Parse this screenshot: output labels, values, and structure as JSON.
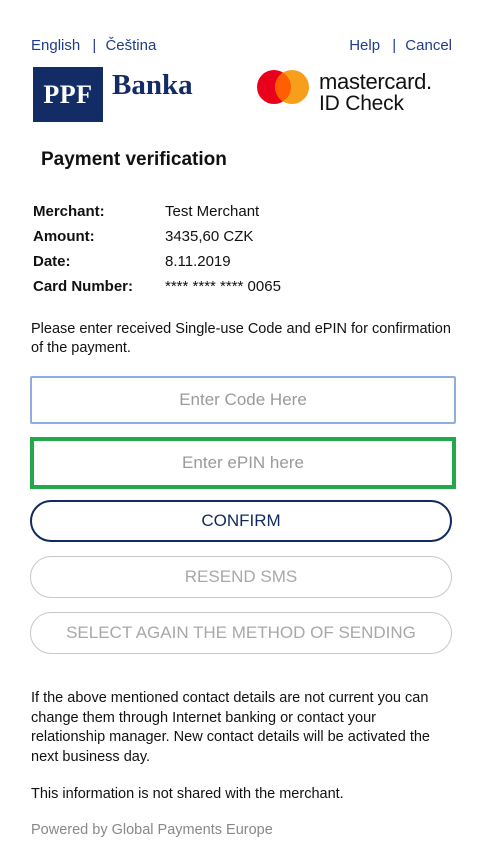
{
  "header": {
    "lang_english": "English",
    "lang_separator": "|",
    "lang_czech": "Čeština",
    "help": "Help",
    "separator": "|",
    "cancel": "Cancel"
  },
  "bank_logo": {
    "box_text": "PPF",
    "name": "Banka",
    "color": "#142c66"
  },
  "mastercard_logo": {
    "line1": "mastercard.",
    "line2": "ID Check"
  },
  "title": "Payment verification",
  "details": [
    {
      "label": "Merchant:",
      "value": "Test Merchant"
    },
    {
      "label": "Amount:",
      "value": "3435,60 CZK"
    },
    {
      "label": "Date:",
      "value": "8.11.2019"
    },
    {
      "label": "Card Number:",
      "value": "**** **** **** 0065"
    }
  ],
  "instruction": "Please enter received Single-use Code and ePIN for confirmation of the payment.",
  "code_input": {
    "placeholder": "Enter Code Here"
  },
  "epin_input": {
    "placeholder": "Enter ePIN here"
  },
  "buttons": {
    "confirm": "CONFIRM",
    "resend": "RESEND SMS",
    "select_again": "SELECT AGAIN THE METHOD OF SENDING"
  },
  "note": "If the above mentioned contact details are not current you can change them through Internet banking or contact your relationship manager. New contact details will be activated the next business day.",
  "not_shared": "This information is not shared with the merchant.",
  "powered_by": "Powered by Global Payments Europe",
  "colors": {
    "accent": "#102a5c",
    "epin_border": "#22a94a",
    "code_border": "#8faee0"
  }
}
